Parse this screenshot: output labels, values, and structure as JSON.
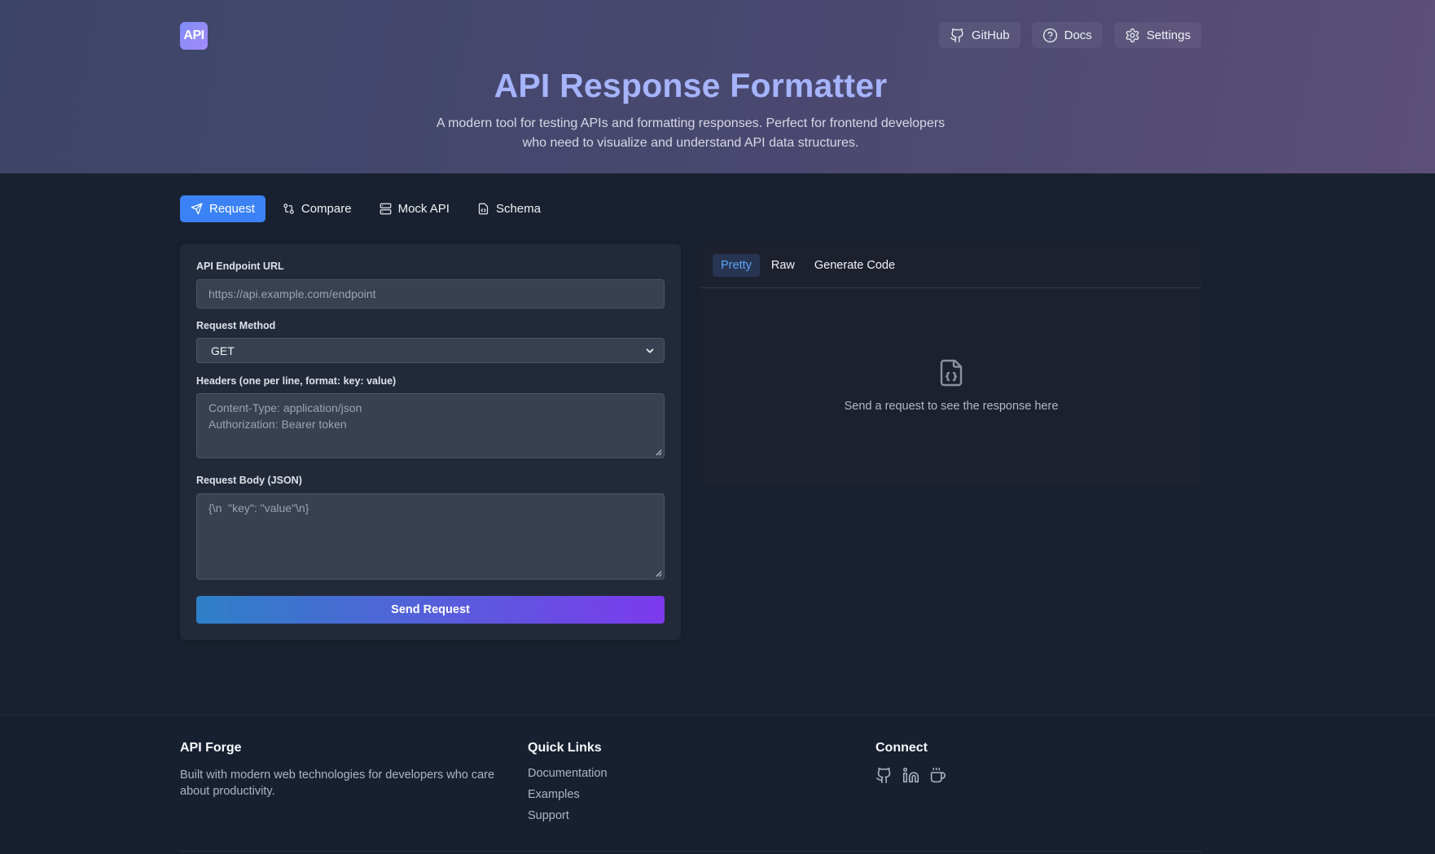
{
  "header": {
    "logo_text": "API",
    "nav": [
      {
        "label": "GitHub",
        "icon": "github-icon"
      },
      {
        "label": "Docs",
        "icon": "help-circle-icon"
      },
      {
        "label": "Settings",
        "icon": "gear-icon"
      }
    ],
    "title": "API Response Formatter",
    "subtitle_line1": "A modern tool for testing APIs and formatting responses. Perfect for frontend developers",
    "subtitle_line2": "who need to visualize and understand API data structures."
  },
  "tabs": [
    {
      "label": "Request",
      "icon": "send-icon",
      "active": true
    },
    {
      "label": "Compare",
      "icon": "git-compare-icon",
      "active": false
    },
    {
      "label": "Mock API",
      "icon": "server-icon",
      "active": false
    },
    {
      "label": "Schema",
      "icon": "file-code-icon",
      "active": false
    }
  ],
  "request_form": {
    "url_label": "API Endpoint URL",
    "url_placeholder": "https://api.example.com/endpoint",
    "method_label": "Request Method",
    "method_value": "GET",
    "headers_label": "Headers (one per line, format: key: value)",
    "headers_placeholder_line1": "Content-Type: application/json",
    "headers_placeholder_line2": "Authorization: Bearer token",
    "body_label": "Request Body (JSON)",
    "body_placeholder": "{\\n  \"key\": \"value\"\\n}",
    "send_label": "Send Request"
  },
  "response": {
    "tabs": [
      {
        "label": "Pretty",
        "active": true
      },
      {
        "label": "Raw",
        "active": false
      },
      {
        "label": "Generate Code",
        "active": false
      }
    ],
    "empty_text": "Send a request to see the response here"
  },
  "footer": {
    "brand": {
      "title": "API Forge",
      "text": "Built with modern web technologies for developers who care about productivity."
    },
    "quick_links": {
      "title": "Quick Links",
      "items": [
        "Documentation",
        "Examples",
        "Support"
      ]
    },
    "connect": {
      "title": "Connect",
      "icons": [
        "github-icon",
        "linkedin-icon",
        "coffee-icon"
      ]
    }
  },
  "colors": {
    "accent": "#3b82f6",
    "title": "#a5b4fc",
    "gradient_start": "#2d80c6",
    "gradient_end": "#7c3aed"
  }
}
